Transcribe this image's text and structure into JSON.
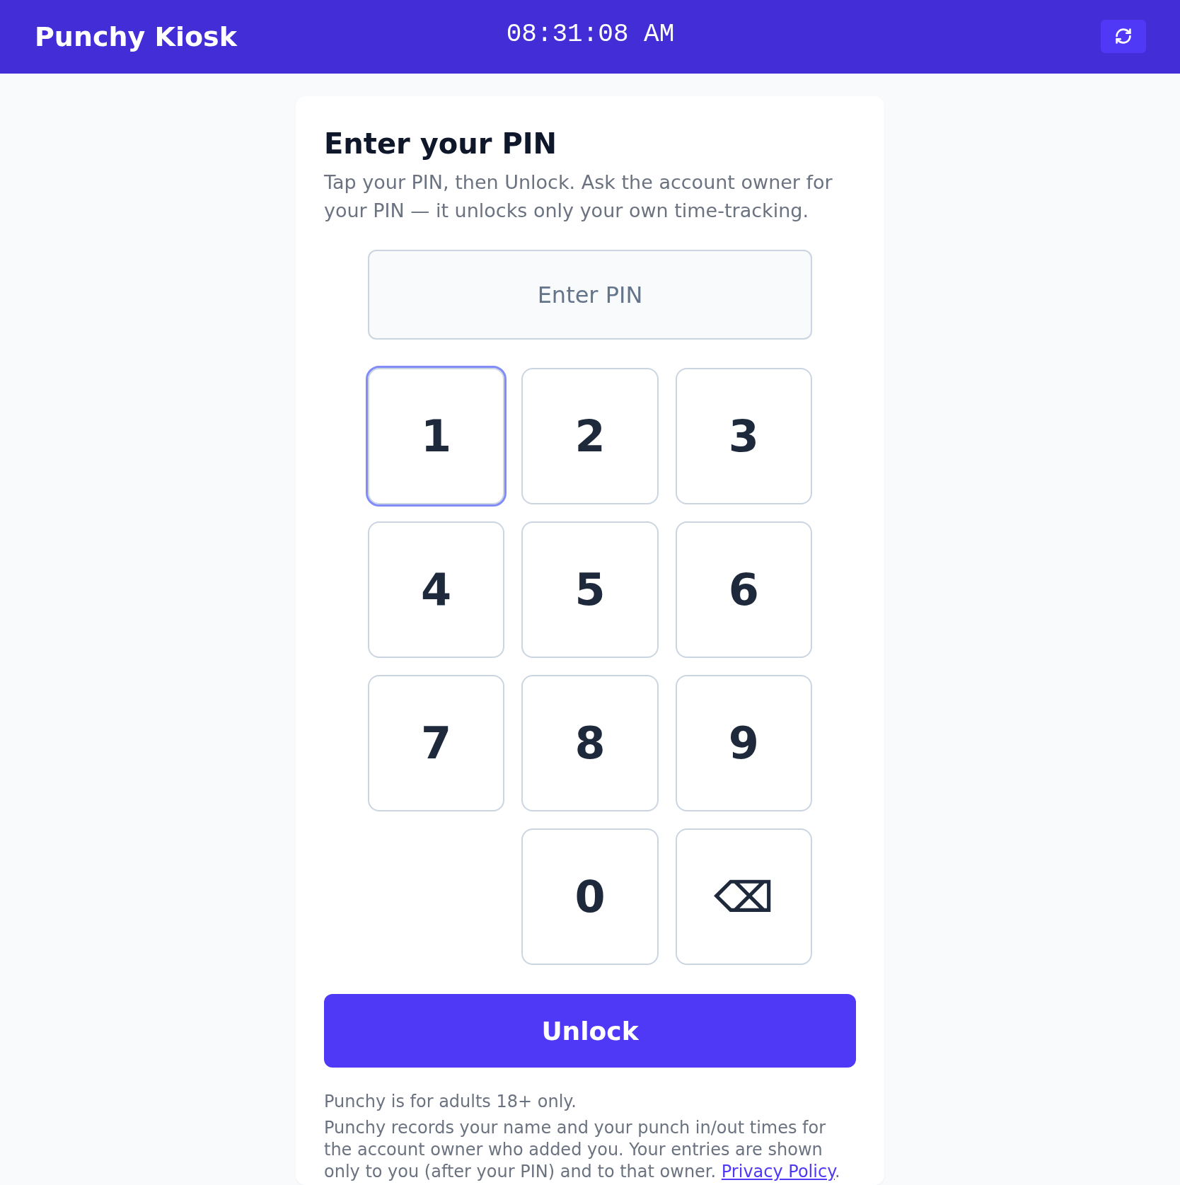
{
  "header": {
    "title": "Punchy Kiosk",
    "clock": "08:31:08 AM"
  },
  "pin_card": {
    "title": "Enter your PIN",
    "instructions": "Tap your PIN, then Unlock. Ask the account owner for your PIN — it unlocks only your own time-tracking.",
    "pin_field": {
      "placeholder": "Enter PIN"
    },
    "keypad": [
      {
        "kind": "digit",
        "label": "1",
        "focused": true
      },
      {
        "kind": "digit",
        "label": "2",
        "focused": false
      },
      {
        "kind": "digit",
        "label": "3",
        "focused": false
      },
      {
        "kind": "digit",
        "label": "4",
        "focused": false
      },
      {
        "kind": "digit",
        "label": "5",
        "focused": false
      },
      {
        "kind": "digit",
        "label": "6",
        "focused": false
      },
      {
        "kind": "digit",
        "label": "7",
        "focused": false
      },
      {
        "kind": "digit",
        "label": "8",
        "focused": false
      },
      {
        "kind": "digit",
        "label": "9",
        "focused": false
      },
      {
        "kind": "digit",
        "label": "0",
        "focused": false
      },
      {
        "kind": "backspace",
        "label": "⌫",
        "focused": false
      }
    ],
    "unlock_button": "Unlock",
    "age_notice": "Punchy is for adults 18+ only.",
    "privacy_notice": {
      "text": "Punchy records your name and your punch in/out times for the account owner who added you. Your entries are shown only to you (after your PIN) and to that owner.",
      "link": "Privacy Policy",
      "end": "."
    }
  }
}
